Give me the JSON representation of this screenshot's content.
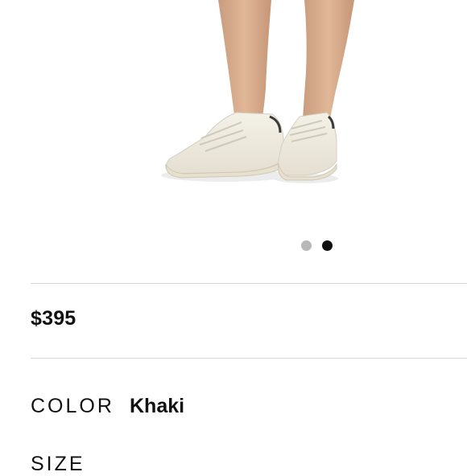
{
  "product": {
    "price": "$395",
    "color_label": "COLOR",
    "color_value": "Khaki",
    "size_label": "SIZE"
  },
  "gallery": {
    "image": "model-wearing-white-low-top-sneakers",
    "dots": [
      {
        "state": "inactive",
        "color": "#b8b8b8"
      },
      {
        "state": "active",
        "color": "#111111"
      }
    ]
  }
}
